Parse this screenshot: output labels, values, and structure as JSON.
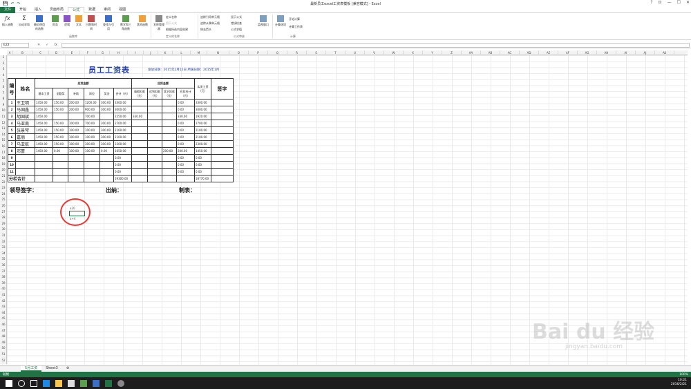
{
  "window": {
    "title": "最新员工excel工资表模板 [兼容模式] - Excel",
    "help": "?",
    "restore": "⊡",
    "minimize": "—",
    "maximize": "☐",
    "close": "✕"
  },
  "qat": {
    "save": "💾",
    "undo": "↶",
    "redo": "↷"
  },
  "tabs": [
    "文件",
    "开始",
    "插入",
    "页面布局",
    "公式",
    "数据",
    "审阅",
    "视图"
  ],
  "ribbon": {
    "buttons": [
      "插入函数",
      "自动求和",
      "最近使用的函数",
      "财务",
      "逻辑",
      "文本",
      "日期和时间",
      "查找与引用",
      "数学和三角函数",
      "其他函数",
      "名称管理器"
    ],
    "small": [
      "定义名称",
      "用于公式",
      "根据所选内容创建",
      "追踪引用单元格",
      "追踪从属单元格",
      "移去箭头",
      "显示公式",
      "错误检查",
      "公式求值",
      "监视窗口",
      "计算选项",
      "开始计算",
      "计算工作表"
    ],
    "groups": [
      "函数库",
      "定义的名称",
      "公式审核",
      "计算"
    ]
  },
  "formula_bar": {
    "name_box": "E22",
    "cancel": "✕",
    "enter": "✓",
    "fx": "fx",
    "value": ""
  },
  "columns": [
    "A",
    "B",
    "C",
    "D",
    "E",
    "F",
    "G",
    "H",
    "I",
    "J",
    "K",
    "L",
    "M",
    "N",
    "O",
    "P",
    "Q",
    "R",
    "S",
    "T",
    "U",
    "V",
    "W",
    "X",
    "Y",
    "Z",
    "AA",
    "AB",
    "AC",
    "AD",
    "AE",
    "AF",
    "AG",
    "AH",
    "AI",
    "AJ",
    "AK"
  ],
  "sheet": {
    "title": "员工工资表",
    "meta": "发放日期：2015年2月12日  所属日期：2015年1月",
    "headers": {
      "no": "编号",
      "name": "姓名",
      "payable": "应发金额",
      "deduct": "应扣金额",
      "net": "实发工资（元）",
      "sign": "签字",
      "sub": [
        "基本工资",
        "全勤奖",
        "补助",
        "岗位",
        "奖金",
        "合计（元）",
        "请假扣款（元）",
        "迟到扣款（元）",
        "其它扣款（元）",
        "应扣合计（元）"
      ]
    },
    "rows": [
      [
        "1",
        "王卫明",
        "1450.00",
        "150.00",
        "200.00",
        "1200.00",
        "300.00",
        "3300.00",
        "",
        "",
        "",
        "0.00",
        "3300.00"
      ],
      [
        "2",
        "马国鑫",
        "1450.00",
        "150.00",
        "200.00",
        "900.00",
        "300.00",
        "3000.00",
        "",
        "",
        "",
        "0.00",
        "3000.00"
      ],
      [
        "3",
        "胡国斌",
        "1450.00",
        "",
        "",
        "700.00",
        "",
        "2250.00",
        "330.00",
        "",
        "",
        "330.00",
        "1920.00"
      ],
      [
        "4",
        "马亚南",
        "1450.00",
        "150.00",
        "100.00",
        "700.00",
        "300.00",
        "2700.00",
        "",
        "",
        "",
        "0.00",
        "2700.00"
      ],
      [
        "5",
        "张景琴",
        "1450.00",
        "150.00",
        "100.00",
        "100.00",
        "300.00",
        "2100.00",
        "",
        "",
        "",
        "0.00",
        "2100.00"
      ],
      [
        "6",
        "嘉丽",
        "1450.00",
        "150.00",
        "100.00",
        "100.00",
        "300.00",
        "2100.00",
        "",
        "",
        "",
        "0.00",
        "2100.00"
      ],
      [
        "7",
        "马亚航",
        "1450.00",
        "150.00",
        "100.00",
        "300.00",
        "300.00",
        "2300.00",
        "",
        "",
        "",
        "0.00",
        "2300.00"
      ],
      [
        "8",
        "邓蕾",
        "1450.00",
        "0.00",
        "100.00",
        "100.00",
        "0.00",
        "1650.00",
        "",
        "",
        "200.00",
        "200.00",
        "1450.00"
      ],
      [
        "9",
        "",
        "",
        "",
        "",
        "",
        "",
        "0.00",
        "",
        "",
        "",
        "0.00",
        "0.00"
      ],
      [
        "10",
        "",
        "",
        "",
        "",
        "",
        "",
        "0.00",
        "",
        "",
        "",
        "0.00",
        "0.00"
      ],
      [
        "11",
        "",
        "",
        "",
        "",
        "",
        "",
        "0.00",
        "",
        "",
        "",
        "0.00",
        "0.00"
      ]
    ],
    "total_label": "分栏合计",
    "total_payable": "19300.00",
    "total_net": "18770.00",
    "footer": {
      "leader": "领导签字：",
      "cashier": "出纳：",
      "maker": "制表："
    },
    "annot": {
      "a": "a20",
      "b": "a+4"
    }
  },
  "sheet_tabs": [
    "5月工资",
    "Sheet3"
  ],
  "add_sheet": "⊕",
  "status": {
    "left": "就绪",
    "zoom": "100%"
  },
  "watermark": {
    "logo": "Bai du 经验",
    "url": "jingyan.baidu.com"
  },
  "clock": {
    "time": "10:21",
    "date": "2016/2/21"
  }
}
